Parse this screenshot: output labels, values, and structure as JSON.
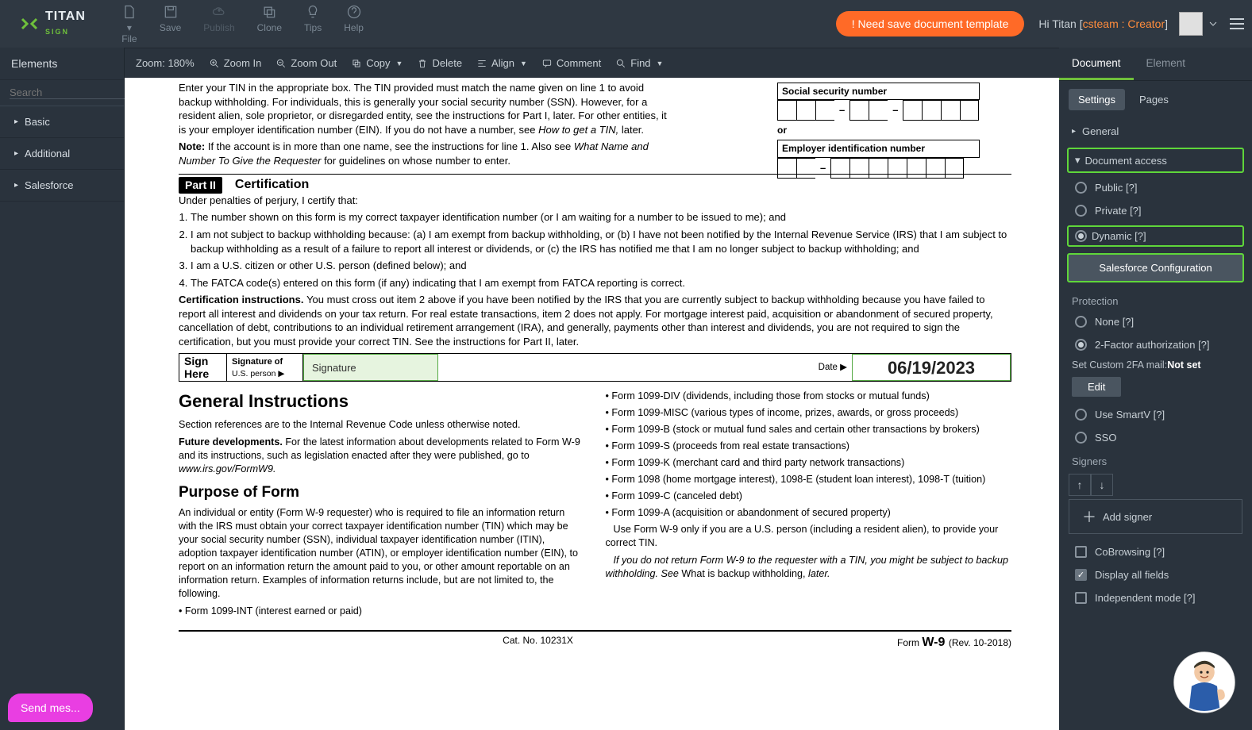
{
  "logo": {
    "brand": "TITAN",
    "sub": "SIGN"
  },
  "headerButtons": {
    "file": "File",
    "save": "Save",
    "publish": "Publish",
    "clone": "Clone",
    "tips": "Tips",
    "help": "Help"
  },
  "alert": "! Need save document template",
  "greet": {
    "prefix": "Hi Titan ",
    "bracket": "[",
    "user": "csteam : Creator",
    "bracket2": "]"
  },
  "toolbar": {
    "zoom": "Zoom: 180%",
    "zoomIn": "Zoom In",
    "zoomOut": "Zoom Out",
    "copy": "Copy",
    "delete": "Delete",
    "align": "Align",
    "comment": "Comment",
    "find": "Find"
  },
  "left": {
    "title": "Elements",
    "searchPh": "Search",
    "items": [
      "Basic",
      "Additional",
      "Salesforce"
    ]
  },
  "doc": {
    "p1a": "Enter your TIN in the appropriate box. The TIN provided must match the name given on line 1 to avoid backup withholding. For individuals, this is generally your social security number (SSN). However, for a resident alien, sole proprietor, or disregarded entity, see the instructions for Part I, later. For other entities, it is your employer identification number (EIN). If you do not have a number, see ",
    "p1b": "How to get a TIN, ",
    "p1c": "later.",
    "p2a": "Note: ",
    "p2b": "If the account is in more than one name, see the instructions for line 1. Also see ",
    "p2c": "What Name and Number To Give the Requester ",
    "p2d": "for guidelines on whose number to enter.",
    "ssn": "Social security number",
    "or": "or",
    "ein": "Employer identification number",
    "part2": "Part II",
    "certTitle": "Certification",
    "under": "Under penalties of perjury, I certify that:",
    "c1": "The number shown on this form is my correct taxpayer identification number (or I am waiting for a number to be issued to me); and",
    "c2": "I am not subject to backup withholding because: (a) I am exempt from backup withholding, or (b) I have not been notified by the Internal Revenue Service (IRS) that I am subject to backup withholding as a result of a failure to report all interest or dividends, or (c) the IRS has notified me that I am no longer subject to backup withholding; and",
    "c3": "I am a U.S. citizen or other U.S. person (defined below); and",
    "c4": "The FATCA code(s) entered on this form (if any) indicating that I am exempt from FATCA reporting is correct.",
    "cib": "Certification instructions. ",
    "ci": "You must cross out item 2 above if you have been notified by the IRS that you are currently subject to backup withholding because you have failed to report all interest and dividends on your tax return. For real estate transactions, item 2 does not apply. For mortgage interest paid, acquisition or abandonment of secured property, cancellation of debt, contributions to an individual retirement arrangement (IRA), and generally, payments other than interest and dividends, you are not required to sign the certification, but you must provide your correct TIN. See the instructions for Part II, later.",
    "signHere": "Sign Here",
    "sigOfA": "Signature of",
    "sigOfB": "U.S. person ▶",
    "sigPh": "Signature",
    "dateLbl": "Date ▶",
    "dateVal": "06/19/2023",
    "giH": "General Instructions",
    "gi1": "Section references are to the Internal Revenue Code unless otherwise noted.",
    "gi2a": "Future developments. ",
    "gi2b": "For the latest information about developments related to Form W-9 and its instructions, such as legislation enacted after they were published, go to ",
    "gi2c": "www.irs.gov/FormW9.",
    "pofH": "Purpose of Form",
    "pof1": "An individual or entity (Form W-9 requester) who is required to file an information return with the IRS must obtain your correct taxpayer identification number (TIN) which may be your social security number (SSN), individual taxpayer identification number (ITIN), adoption taxpayer identification number (ATIN), or employer identification number (EIN), to report on an information return the amount paid to you, or other amount reportable on an information return. Examples of information returns include, but are not limited to, the following.",
    "pof2": "• Form 1099-INT (interest earned or paid)",
    "rcol": [
      "Form 1099-DIV (dividends, including those from stocks or mutual funds)",
      "Form 1099-MISC (various types of income, prizes, awards, or gross proceeds)",
      "Form 1099-B (stock or mutual fund sales and certain other transactions by brokers)",
      "Form 1099-S (proceeds from real estate transactions)",
      "Form 1099-K (merchant card and third party network transactions)",
      "Form 1098 (home mortgage interest), 1098-E (student loan interest), 1098-T (tuition)",
      "Form 1099-C (canceled debt)",
      "Form 1099-A (acquisition or abandonment of secured property)"
    ],
    "rp1": "  Use Form W-9 only if you are a U.S. person (including a resident alien), to provide your correct TIN.",
    "rp2a": "  If you do not return Form W-9 to the requester with a TIN, you might be subject to backup withholding. See ",
    "rp2b": "What is backup withholding, ",
    "rp2c": "later.",
    "foot1": "Cat. No. 10231X",
    "foot2a": "Form ",
    "foot2b": "W-9 ",
    "foot2c": "(Rev. 10-2018)"
  },
  "right": {
    "tabDoc": "Document",
    "tabEl": "Element",
    "settings": "Settings",
    "pages": "Pages",
    "general": "General",
    "docAccess": "Document access",
    "public": "Public [?]",
    "private": "Private [?]",
    "dynamic": "Dynamic [?]",
    "sfConfig": "Salesforce Configuration",
    "protection": "Protection",
    "none": "None [?]",
    "twofa": "2-Factor authorization [?]",
    "custom2fa": "Set Custom 2FA mail:",
    "notset": "Not set",
    "edit": "Edit",
    "smartv": "Use SmartV [?]",
    "sso": "SSO",
    "signers": "Signers",
    "addSigner": "Add signer",
    "cobrowse": "CoBrowsing [?]",
    "displayAll": "Display all fields",
    "independent": "Independent mode [?]"
  },
  "chat": "Send mes..."
}
